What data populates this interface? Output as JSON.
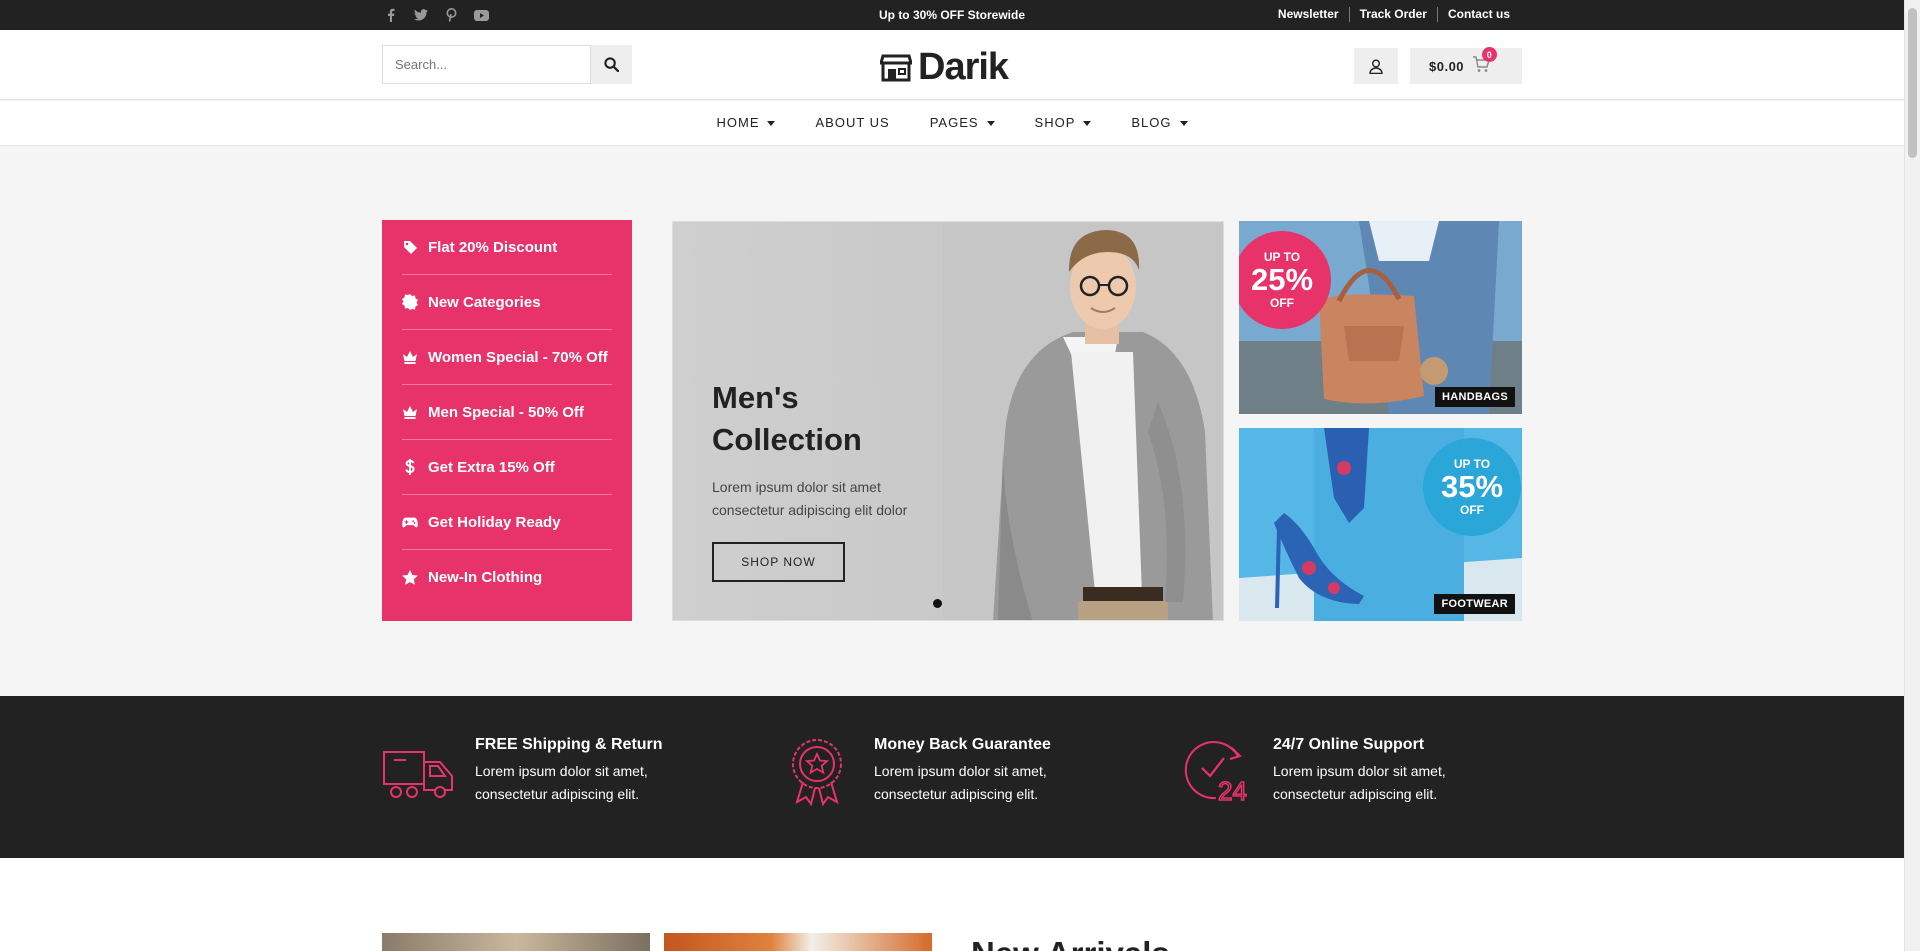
{
  "topbar": {
    "social_icons": [
      "facebook-icon",
      "twitter-icon",
      "pinterest-icon",
      "youtube-icon"
    ],
    "promo": "Up to 30% OFF Storewide",
    "links": [
      "Newsletter",
      "Track Order",
      "Contact us"
    ]
  },
  "header": {
    "search_placeholder": "Search...",
    "logo": "Darik",
    "cart_total": "$0.00",
    "cart_count": "0"
  },
  "nav": {
    "items": [
      {
        "label": "HOME",
        "dropdown": true
      },
      {
        "label": "ABOUT US",
        "dropdown": false
      },
      {
        "label": "PAGES",
        "dropdown": true
      },
      {
        "label": "SHOP",
        "dropdown": true
      },
      {
        "label": "BLOG",
        "dropdown": true
      }
    ]
  },
  "side_menu": [
    {
      "label": "Flat 20% Discount",
      "icon": "tag-icon"
    },
    {
      "label": "New Categories",
      "icon": "badge-icon"
    },
    {
      "label": "Women Special - 70% Off",
      "icon": "crown-icon"
    },
    {
      "label": "Men Special - 50% Off",
      "icon": "crown-icon"
    },
    {
      "label": "Get Extra 15% Off",
      "icon": "dollar-icon"
    },
    {
      "label": "Get Holiday Ready",
      "icon": "gamepad-icon"
    },
    {
      "label": "New-In Clothing",
      "icon": "star-icon"
    }
  ],
  "slider": {
    "title": "Men's Collection",
    "text": "Lorem ipsum dolor sit amet consectetur adipiscing elit dolor",
    "button": "SHOP NOW"
  },
  "promos": [
    {
      "top": "UP TO",
      "value": "25%",
      "bottom": "OFF",
      "tag": "HANDBAGS",
      "circle_color": "#e8336a"
    },
    {
      "top": "UP TO",
      "value": "35%",
      "bottom": "OFF",
      "tag": "FOOTWEAR",
      "circle_color": "#2aa6d8"
    }
  ],
  "features": [
    {
      "title": "FREE Shipping & Return",
      "text": "Lorem ipsum dolor sit amet, consectetur adipiscing elit.",
      "icon": "truck-icon"
    },
    {
      "title": "Money Back Guarantee",
      "text": "Lorem ipsum dolor sit amet, consectetur adipiscing elit.",
      "icon": "medal-icon"
    },
    {
      "title": "24/7 Online Support",
      "text": "Lorem ipsum dolor sit amet, consectetur adipiscing elit.",
      "icon": "clock-24-icon"
    }
  ],
  "section": {
    "title": "New Arrivals"
  },
  "colors": {
    "accent": "#e8336a",
    "dark": "#222222"
  }
}
